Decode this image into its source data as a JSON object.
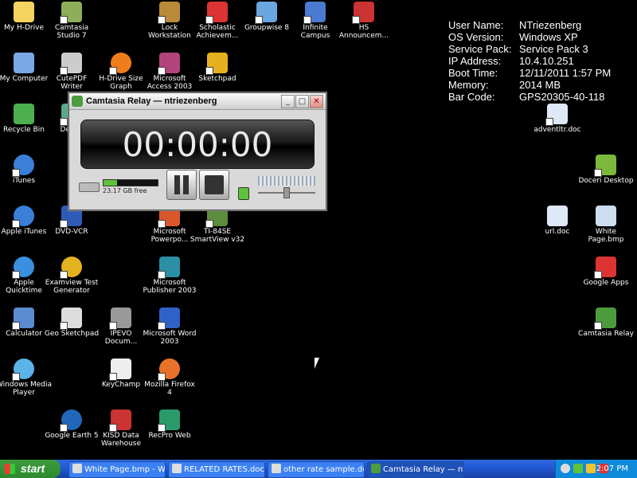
{
  "desktop_icons": [
    {
      "label": "My H-Drive",
      "icon": "folder-icon",
      "color": "#f4d35e"
    },
    {
      "label": "Camtasia\nStudio 7",
      "icon": "camtasia-studio-icon",
      "color": "#8fae5a"
    },
    {
      "label": "Lock\nWorkstation",
      "icon": "lock-icon",
      "color": "#b88a3a"
    },
    {
      "label": "Scholastic\nAchievem...",
      "icon": "scholastic-icon",
      "color": "#d33"
    },
    {
      "label": "Groupwise 8",
      "icon": "groupwise-icon",
      "color": "#6aa6e0"
    },
    {
      "label": "Infinite\nCampus",
      "icon": "campus-icon",
      "color": "#4a7bd1"
    },
    {
      "label": "HS\nAnnouncem...",
      "icon": "announcement-icon",
      "color": "#c33"
    },
    {
      "label": "My Computer",
      "icon": "computer-icon",
      "color": "#7aa7e5"
    },
    {
      "label": "CutePDF\nWriter",
      "icon": "printer-icon",
      "color": "#ccc"
    },
    {
      "label": "H-Drive Size\nGraph",
      "icon": "pie-chart-icon",
      "color": "#f07d1b"
    },
    {
      "label": "Microsoft\nAccess 2003",
      "icon": "access-icon",
      "color": "#b1447d"
    },
    {
      "label": "Sketchpad",
      "icon": "sketchpad-icon",
      "color": "#e6b120"
    },
    {
      "label": "Recycle Bin",
      "icon": "recycle-bin-icon",
      "color": "#4caf50"
    },
    {
      "label": "Destin",
      "icon": "destin-icon",
      "color": "#5a8"
    },
    {
      "label": "iTunes",
      "icon": "itunes-icon",
      "color": "#3a7fd8"
    },
    {
      "label": "Apple iTunes",
      "icon": "itunes-icon",
      "color": "#3a7fd8"
    },
    {
      "label": "DVD-VCR",
      "icon": "dvd-icon",
      "color": "#2f5bb8"
    },
    {
      "label": "Microsoft\nPowerpo...",
      "icon": "powerpoint-icon",
      "color": "#d9572b"
    },
    {
      "label": "TI-84SE\nSmartView v32",
      "icon": "calculator-icon",
      "color": "#5c8c3d"
    },
    {
      "label": "Apple\nQuicktime",
      "icon": "quicktime-icon",
      "color": "#3a8fe0"
    },
    {
      "label": "Examview Test\nGenerator",
      "icon": "examview-icon",
      "color": "#e2b21f"
    },
    {
      "label": "Microsoft\nPublisher 2003",
      "icon": "publisher-icon",
      "color": "#2b8fa5"
    },
    {
      "label": "Calculator",
      "icon": "calculator-icon",
      "color": "#5b8bd0"
    },
    {
      "label": "Geo Sketchpad",
      "icon": "geo-sketchpad-icon",
      "color": "#ddd"
    },
    {
      "label": "IPEVO\nDocum...",
      "icon": "document-camera-icon",
      "color": "#999"
    },
    {
      "label": "Microsoft Word\n2003",
      "icon": "word-icon",
      "color": "#2f62c9"
    },
    {
      "label": "Windows Media\nPlayer",
      "icon": "media-player-icon",
      "color": "#5bb3e8"
    },
    {
      "label": "KeyChamp",
      "icon": "keychamp-icon",
      "color": "#eee"
    },
    {
      "label": "Mozilla Firefox\n4",
      "icon": "firefox-icon",
      "color": "#e8722a"
    },
    {
      "label": "Google Earth 5",
      "icon": "google-earth-icon",
      "color": "#2266bb"
    },
    {
      "label": "KISD Data\nWarehouse",
      "icon": "warehouse-icon",
      "color": "#c33"
    },
    {
      "label": "RecPro Web",
      "icon": "recpro-icon",
      "color": "#2a9a6a"
    },
    {
      "label": "adventltr.doc",
      "icon": "word-doc-icon",
      "color": "#dfe8f7"
    },
    {
      "label": "Doceri Desktop",
      "icon": "doceri-icon",
      "color": "#7cb83b"
    },
    {
      "label": "url.doc",
      "icon": "word-doc-icon",
      "color": "#dfe8f7"
    },
    {
      "label": "White\nPage.bmp",
      "icon": "bitmap-icon",
      "color": "#cde"
    },
    {
      "label": "Google Apps",
      "icon": "google-apps-icon",
      "color": "#d33"
    },
    {
      "label": "Camtasia Relay",
      "icon": "camtasia-relay-icon",
      "color": "#4c9b3d"
    }
  ],
  "sysinfo": [
    {
      "key": "User Name:",
      "value": "NTriezenberg"
    },
    {
      "key": "OS Version:",
      "value": "Windows XP"
    },
    {
      "key": "Service Pack:",
      "value": "Service Pack 3"
    },
    {
      "key": "IP Address:",
      "value": "10.4.10.251"
    },
    {
      "key": "Boot Time:",
      "value": "12/11/2011 1:57 PM"
    },
    {
      "key": "Memory:",
      "value": "2014 MB"
    },
    {
      "key": "Bar Code:",
      "value": "GPS20305-40-118"
    }
  ],
  "relay_window": {
    "title": "Camtasia Relay — ntriezenberg",
    "timer": "00:00:00",
    "disk_free": "23.17 GB free",
    "disk_used_fraction": 0.25,
    "minimize": "_",
    "maximize": "□",
    "close": "✕"
  },
  "taskbar": {
    "start_label": "start",
    "tasks": [
      {
        "label": "White Page.bmp - Wi...",
        "active": false
      },
      {
        "label": "RELATED RATES.doc ...",
        "active": false
      },
      {
        "label": "other rate sample.do...",
        "active": false
      },
      {
        "label": "Camtasia Relay — ntr...",
        "active": true
      }
    ],
    "clock": "2:07 PM"
  }
}
